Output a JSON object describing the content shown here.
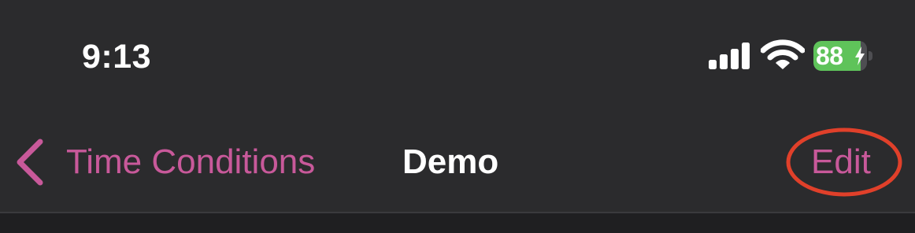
{
  "status_bar": {
    "time": "9:13",
    "battery_percent": "88",
    "battery_level": 0.88,
    "charging": true
  },
  "nav_bar": {
    "back_label": "Time Conditions",
    "title": "Demo",
    "edit_label": "Edit"
  },
  "icons": {
    "back": "chevron-left-icon",
    "signal": "cellular-signal-icon",
    "wifi": "wifi-icon",
    "battery": "battery-icon",
    "charging": "lightning-bolt-icon"
  },
  "colors": {
    "background": "#2b2b2d",
    "accent": "#c8599a",
    "battery_fill": "#5fc35a",
    "annotation": "#e0402a"
  }
}
